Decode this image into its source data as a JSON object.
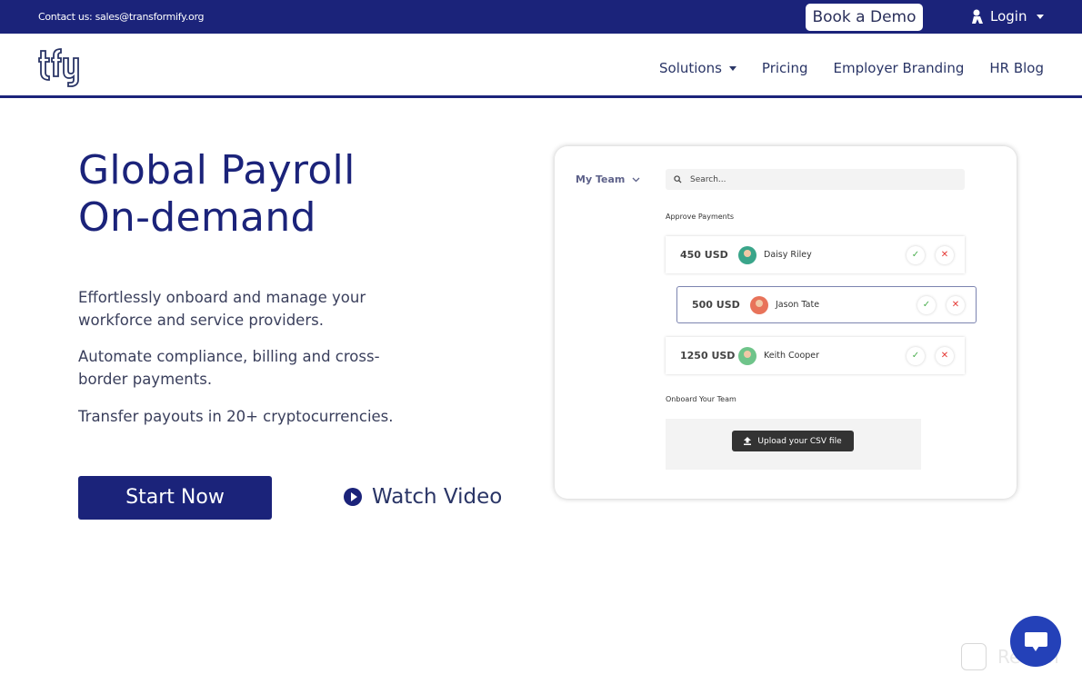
{
  "topbar": {
    "contact": "Contact us: sales@transformify.org",
    "book_demo": "Book a Demo",
    "login": "Login"
  },
  "navbar": {
    "logo_text": "tfy",
    "items": [
      {
        "label": "Solutions",
        "dropdown": true
      },
      {
        "label": "Pricing"
      },
      {
        "label": "Employer Branding"
      },
      {
        "label": "HR Blog"
      }
    ]
  },
  "hero": {
    "title_line1": "Global Payroll",
    "title_line2": "On-demand",
    "paragraphs": [
      "Effortlessly onboard and manage your workforce and service providers.",
      "Automate compliance, billing and cross-border payments.",
      "Transfer payouts in 20+ cryptocurrencies."
    ],
    "start_button": "Start Now",
    "watch_video": "Watch Video"
  },
  "mockup": {
    "team_selector": "My Team",
    "search_placeholder": "Search...",
    "approve_label": "Approve Payments",
    "payments": [
      {
        "amount": "450 USD",
        "name": "Daisy Riley",
        "avatar_color": "#3aa58a"
      },
      {
        "amount": "500 USD",
        "name": "Jason Tate",
        "avatar_color": "#e8735a"
      },
      {
        "amount": "1250 USD",
        "name": "Keith Cooper",
        "avatar_color": "#6fc48a"
      }
    ],
    "onboard_label": "Onboard Your Team",
    "upload_button": "Upload your CSV file"
  },
  "watermark": {
    "text": "Revain"
  },
  "colors": {
    "brand": "#1b237a",
    "chat": "#2441b8",
    "approve": "#4caf50",
    "reject": "#e53935"
  }
}
